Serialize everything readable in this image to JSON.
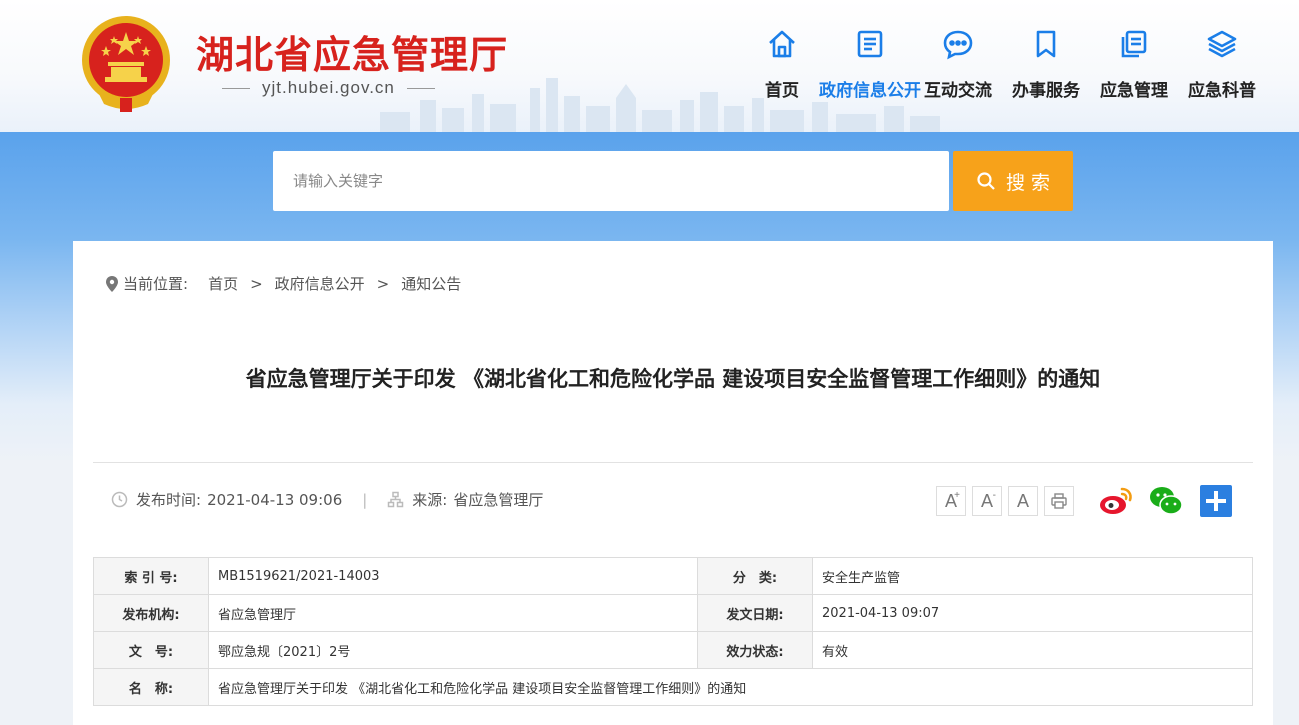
{
  "site": {
    "title": "湖北省应急管理厅",
    "domain": "yjt.hubei.gov.cn"
  },
  "nav": [
    {
      "label": "首页",
      "icon": "home-icon",
      "active": false
    },
    {
      "label": "政府信息公开",
      "icon": "document-icon",
      "active": true
    },
    {
      "label": "互动交流",
      "icon": "chat-icon",
      "active": false
    },
    {
      "label": "办事服务",
      "icon": "bookmark-icon",
      "active": false
    },
    {
      "label": "应急管理",
      "icon": "files-icon",
      "active": false
    },
    {
      "label": "应急科普",
      "icon": "layers-icon",
      "active": false
    }
  ],
  "search": {
    "placeholder": "请输入关键字",
    "button_label": "搜 索"
  },
  "breadcrumb": {
    "prefix": "当前位置:",
    "items": [
      "首页",
      "政府信息公开",
      "通知公告"
    ],
    "separator": ">"
  },
  "article": {
    "title": "省应急管理厅关于印发 《湖北省化工和危险化学品 建设项目安全监督管理工作细则》的通知",
    "publish_label": "发布时间:",
    "publish_time": "2021-04-13 09:06",
    "meta_separator": "|",
    "source_label": "来源:",
    "source": "省应急管理厅"
  },
  "tools": {
    "font_large": "A",
    "font_large_sup": "+",
    "font_small": "A",
    "font_small_sup": "-",
    "font_normal": "A"
  },
  "info": {
    "rows": [
      {
        "l1": "索 引 号:",
        "v1": "MB1519621/2021-14003",
        "l2": "分　类:",
        "v2": "安全生产监管"
      },
      {
        "l1": "发布机构:",
        "v1": "省应急管理厅",
        "l2": "发文日期:",
        "v2": "2021-04-13 09:07"
      },
      {
        "l1": "文　号:",
        "v1": "鄂应急规〔2021〕2号",
        "l2": "效力状态:",
        "v2": "有效"
      }
    ],
    "name_label": "名　称:",
    "name_value": "省应急管理厅关于印发 《湖北省化工和危险化学品 建设项目安全监督管理工作细则》的通知"
  },
  "colors": {
    "title_red": "#d7221d",
    "nav_active": "#1b7ee8",
    "search_button": "#f7a21a",
    "banner_blue": "#5aa2ec"
  }
}
